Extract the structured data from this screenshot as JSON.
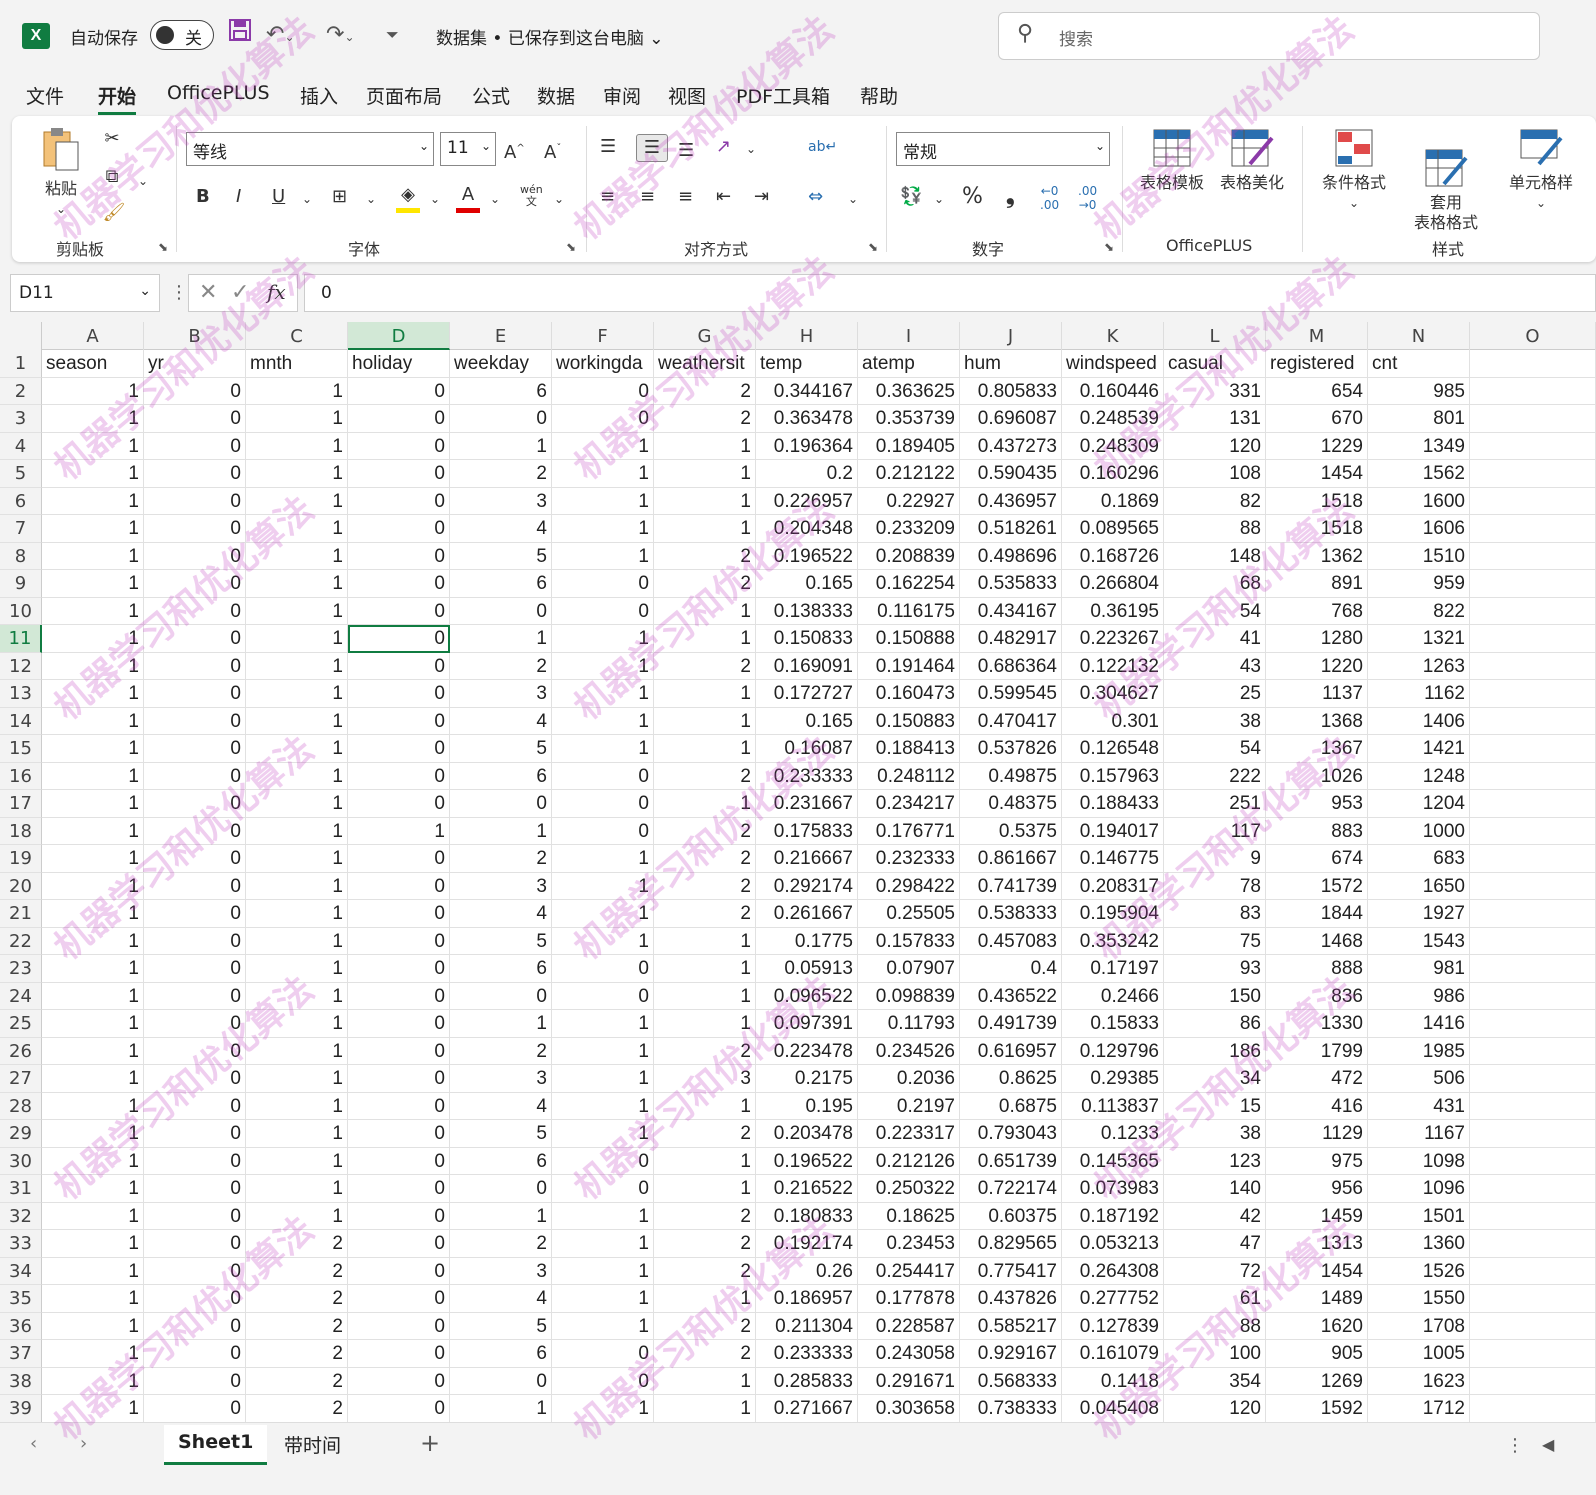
{
  "titlebar": {
    "app_icon": "X",
    "autosave_label": "自动保存",
    "autosave_state": "关",
    "doc_title": "数据集 • 已保存到这台电脑",
    "search_placeholder": "搜索"
  },
  "menu": [
    "文件",
    "开始",
    "OfficePLUS",
    "插入",
    "页面布局",
    "公式",
    "数据",
    "审阅",
    "视图",
    "PDF工具箱",
    "帮助"
  ],
  "ribbon": {
    "clipboard": {
      "label": "剪贴板",
      "paste": "粘贴"
    },
    "font": {
      "label": "字体",
      "name": "等线",
      "size": "11",
      "bold": "B",
      "italic": "I",
      "underline": "U"
    },
    "alignment": {
      "label": "对齐方式"
    },
    "number": {
      "label": "数字",
      "format": "常规",
      "percent": "%",
      "comma": "❟"
    },
    "officeplus": {
      "label": "OfficePLUS",
      "table_template": "表格模板",
      "table_beautify": "表格美化"
    },
    "styles": {
      "label": "样式",
      "conditional": "条件格式",
      "table_format": "套用\n表格格式",
      "cell_style": "单元格样"
    }
  },
  "formula_bar": {
    "name_box": "D11",
    "fx": "fx",
    "value": "0"
  },
  "columns": [
    "A",
    "B",
    "C",
    "D",
    "E",
    "F",
    "G",
    "H",
    "I",
    "J",
    "K",
    "L",
    "M",
    "N",
    "O"
  ],
  "selected_col": "D",
  "selected_row": 11,
  "header_row": [
    "season",
    "yr",
    "mnth",
    "holiday",
    "weekday",
    "workingda",
    "weathersit",
    "temp",
    "atemp",
    "hum",
    "windspeed",
    "casual",
    "registered",
    "cnt"
  ],
  "rows": [
    [
      "1",
      "0",
      "1",
      "0",
      "6",
      "0",
      "2",
      "0.344167",
      "0.363625",
      "0.805833",
      "0.160446",
      "331",
      "654",
      "985"
    ],
    [
      "1",
      "0",
      "1",
      "0",
      "0",
      "0",
      "2",
      "0.363478",
      "0.353739",
      "0.696087",
      "0.248539",
      "131",
      "670",
      "801"
    ],
    [
      "1",
      "0",
      "1",
      "0",
      "1",
      "1",
      "1",
      "0.196364",
      "0.189405",
      "0.437273",
      "0.248309",
      "120",
      "1229",
      "1349"
    ],
    [
      "1",
      "0",
      "1",
      "0",
      "2",
      "1",
      "1",
      "0.2",
      "0.212122",
      "0.590435",
      "0.160296",
      "108",
      "1454",
      "1562"
    ],
    [
      "1",
      "0",
      "1",
      "0",
      "3",
      "1",
      "1",
      "0.226957",
      "0.22927",
      "0.436957",
      "0.1869",
      "82",
      "1518",
      "1600"
    ],
    [
      "1",
      "0",
      "1",
      "0",
      "4",
      "1",
      "1",
      "0.204348",
      "0.233209",
      "0.518261",
      "0.089565",
      "88",
      "1518",
      "1606"
    ],
    [
      "1",
      "0",
      "1",
      "0",
      "5",
      "1",
      "2",
      "0.196522",
      "0.208839",
      "0.498696",
      "0.168726",
      "148",
      "1362",
      "1510"
    ],
    [
      "1",
      "0",
      "1",
      "0",
      "6",
      "0",
      "2",
      "0.165",
      "0.162254",
      "0.535833",
      "0.266804",
      "68",
      "891",
      "959"
    ],
    [
      "1",
      "0",
      "1",
      "0",
      "0",
      "0",
      "1",
      "0.138333",
      "0.116175",
      "0.434167",
      "0.36195",
      "54",
      "768",
      "822"
    ],
    [
      "1",
      "0",
      "1",
      "0",
      "1",
      "1",
      "1",
      "0.150833",
      "0.150888",
      "0.482917",
      "0.223267",
      "41",
      "1280",
      "1321"
    ],
    [
      "1",
      "0",
      "1",
      "0",
      "2",
      "1",
      "2",
      "0.169091",
      "0.191464",
      "0.686364",
      "0.122132",
      "43",
      "1220",
      "1263"
    ],
    [
      "1",
      "0",
      "1",
      "0",
      "3",
      "1",
      "1",
      "0.172727",
      "0.160473",
      "0.599545",
      "0.304627",
      "25",
      "1137",
      "1162"
    ],
    [
      "1",
      "0",
      "1",
      "0",
      "4",
      "1",
      "1",
      "0.165",
      "0.150883",
      "0.470417",
      "0.301",
      "38",
      "1368",
      "1406"
    ],
    [
      "1",
      "0",
      "1",
      "0",
      "5",
      "1",
      "1",
      "0.16087",
      "0.188413",
      "0.537826",
      "0.126548",
      "54",
      "1367",
      "1421"
    ],
    [
      "1",
      "0",
      "1",
      "0",
      "6",
      "0",
      "2",
      "0.233333",
      "0.248112",
      "0.49875",
      "0.157963",
      "222",
      "1026",
      "1248"
    ],
    [
      "1",
      "0",
      "1",
      "0",
      "0",
      "0",
      "1",
      "0.231667",
      "0.234217",
      "0.48375",
      "0.188433",
      "251",
      "953",
      "1204"
    ],
    [
      "1",
      "0",
      "1",
      "1",
      "1",
      "0",
      "2",
      "0.175833",
      "0.176771",
      "0.5375",
      "0.194017",
      "117",
      "883",
      "1000"
    ],
    [
      "1",
      "0",
      "1",
      "0",
      "2",
      "1",
      "2",
      "0.216667",
      "0.232333",
      "0.861667",
      "0.146775",
      "9",
      "674",
      "683"
    ],
    [
      "1",
      "0",
      "1",
      "0",
      "3",
      "1",
      "2",
      "0.292174",
      "0.298422",
      "0.741739",
      "0.208317",
      "78",
      "1572",
      "1650"
    ],
    [
      "1",
      "0",
      "1",
      "0",
      "4",
      "1",
      "2",
      "0.261667",
      "0.25505",
      "0.538333",
      "0.195904",
      "83",
      "1844",
      "1927"
    ],
    [
      "1",
      "0",
      "1",
      "0",
      "5",
      "1",
      "1",
      "0.1775",
      "0.157833",
      "0.457083",
      "0.353242",
      "75",
      "1468",
      "1543"
    ],
    [
      "1",
      "0",
      "1",
      "0",
      "6",
      "0",
      "1",
      "0.05913",
      "0.07907",
      "0.4",
      "0.17197",
      "93",
      "888",
      "981"
    ],
    [
      "1",
      "0",
      "1",
      "0",
      "0",
      "0",
      "1",
      "0.096522",
      "0.098839",
      "0.436522",
      "0.2466",
      "150",
      "836",
      "986"
    ],
    [
      "1",
      "0",
      "1",
      "0",
      "1",
      "1",
      "1",
      "0.097391",
      "0.11793",
      "0.491739",
      "0.15833",
      "86",
      "1330",
      "1416"
    ],
    [
      "1",
      "0",
      "1",
      "0",
      "2",
      "1",
      "2",
      "0.223478",
      "0.234526",
      "0.616957",
      "0.129796",
      "186",
      "1799",
      "1985"
    ],
    [
      "1",
      "0",
      "1",
      "0",
      "3",
      "1",
      "3",
      "0.2175",
      "0.2036",
      "0.8625",
      "0.29385",
      "34",
      "472",
      "506"
    ],
    [
      "1",
      "0",
      "1",
      "0",
      "4",
      "1",
      "1",
      "0.195",
      "0.2197",
      "0.6875",
      "0.113837",
      "15",
      "416",
      "431"
    ],
    [
      "1",
      "0",
      "1",
      "0",
      "5",
      "1",
      "2",
      "0.203478",
      "0.223317",
      "0.793043",
      "0.1233",
      "38",
      "1129",
      "1167"
    ],
    [
      "1",
      "0",
      "1",
      "0",
      "6",
      "0",
      "1",
      "0.196522",
      "0.212126",
      "0.651739",
      "0.145365",
      "123",
      "975",
      "1098"
    ],
    [
      "1",
      "0",
      "1",
      "0",
      "0",
      "0",
      "1",
      "0.216522",
      "0.250322",
      "0.722174",
      "0.073983",
      "140",
      "956",
      "1096"
    ],
    [
      "1",
      "0",
      "1",
      "0",
      "1",
      "1",
      "2",
      "0.180833",
      "0.18625",
      "0.60375",
      "0.187192",
      "42",
      "1459",
      "1501"
    ],
    [
      "1",
      "0",
      "2",
      "0",
      "2",
      "1",
      "2",
      "0.192174",
      "0.23453",
      "0.829565",
      "0.053213",
      "47",
      "1313",
      "1360"
    ],
    [
      "1",
      "0",
      "2",
      "0",
      "3",
      "1",
      "2",
      "0.26",
      "0.254417",
      "0.775417",
      "0.264308",
      "72",
      "1454",
      "1526"
    ],
    [
      "1",
      "0",
      "2",
      "0",
      "4",
      "1",
      "1",
      "0.186957",
      "0.177878",
      "0.437826",
      "0.277752",
      "61",
      "1489",
      "1550"
    ],
    [
      "1",
      "0",
      "2",
      "0",
      "5",
      "1",
      "2",
      "0.211304",
      "0.228587",
      "0.585217",
      "0.127839",
      "88",
      "1620",
      "1708"
    ],
    [
      "1",
      "0",
      "2",
      "0",
      "6",
      "0",
      "2",
      "0.233333",
      "0.243058",
      "0.929167",
      "0.161079",
      "100",
      "905",
      "1005"
    ],
    [
      "1",
      "0",
      "2",
      "0",
      "0",
      "0",
      "1",
      "0.285833",
      "0.291671",
      "0.568333",
      "0.1418",
      "354",
      "1269",
      "1623"
    ],
    [
      "1",
      "0",
      "2",
      "0",
      "1",
      "1",
      "1",
      "0.271667",
      "0.303658",
      "0.738333",
      "0.045408",
      "120",
      "1592",
      "1712"
    ]
  ],
  "sheets": [
    "Sheet1",
    "带时间"
  ],
  "watermark_text": "机器学习和优化算法"
}
